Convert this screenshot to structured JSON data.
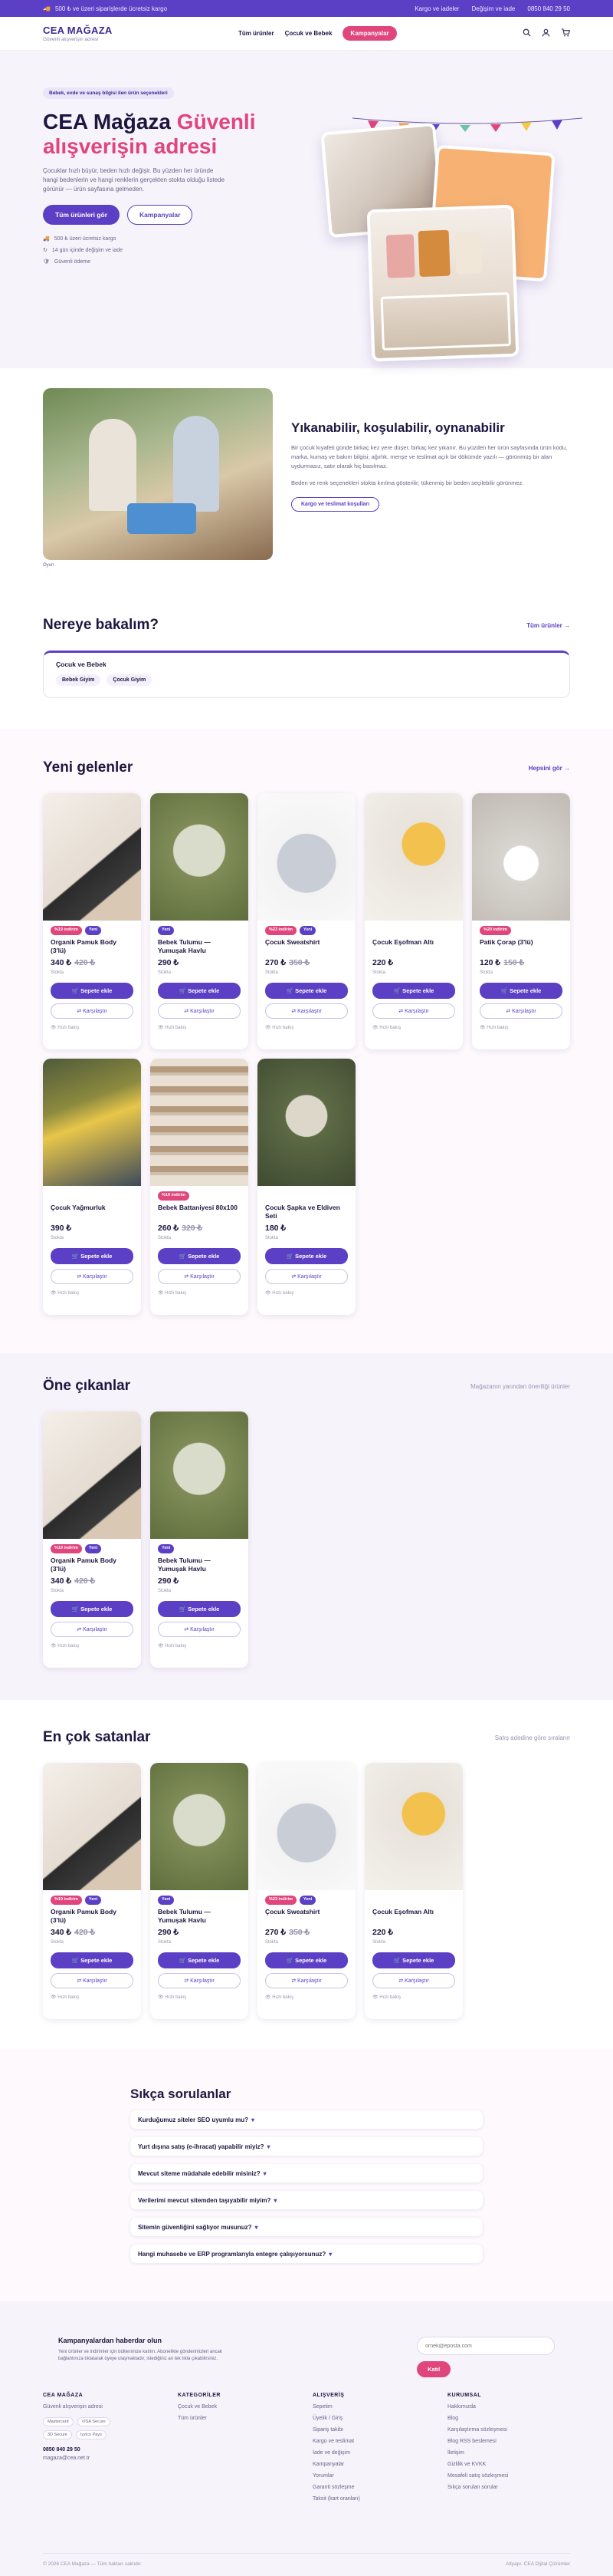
{
  "topbar": {
    "promo": "500 ₺ ve üzeri siparişlerde ücretsiz kargo",
    "links": [
      "Kargo ve iadeler",
      "Değişim ve iade",
      "0850 840 29 50"
    ]
  },
  "header": {
    "brand": "CEA MAĞAZA",
    "tagline": "Güvenli alışverişin adresi",
    "nav": [
      "Tüm ürünler",
      "Çocuk ve Bebek",
      "Kampanyalar"
    ],
    "icons": [
      "search-icon",
      "user-icon",
      "cart-icon"
    ]
  },
  "hero": {
    "badge": "Bebek, evde ve sunaş bilgisi ilen ürün seçenekleri",
    "title_1": "CEA Mağaza",
    "title_accent_1": "Güvenli",
    "title_accent_2": "alışverişin adresi",
    "lead": "Çocuklar hızlı büyür, beden hızlı değişir. Bu yüzden her üründe hangi bedenlerin ve hangi renklerin gerçekten stokta olduğu listede görünür — ürün sayfasına gelmeden.",
    "cta_primary": "Tüm ürünleri gör",
    "cta_secondary": "Kampanyalar",
    "perks": [
      "500 ₺ üzeri ücretsiz kargo",
      "14 gün içinde değişim ve iade",
      "Güvenli ödeme"
    ]
  },
  "wash": {
    "title": "Yıkanabilir, koşulabilir, oynanabilir",
    "p1": "Bir çocuk kıyafeti günde birkaç kez yere düşer, birkaç kez yıkanır. Bu yüzden her ürün sayfasında ürün kodu, marka, kumaş ve bakım bilgisi; ağırlık, menşe ve teslimat açık bir dökümde yazılı — görünmüş bir alan uydurmasız, satır olarak hiç basılmaz.",
    "p2": "Beden ve renk seçenekleri stokta kırılma gösterilir; tükenmiş bir beden seçilebilir görünmez.",
    "button": "Kargo ve teslimat koşulları",
    "caption": "Oyun"
  },
  "categories": {
    "title": "Nereye bakalım?",
    "link": "Tüm ürünler",
    "box_title": "Çocuk ve Bebek",
    "chips": [
      "Bebek Giyim",
      "Çocuk Giyim"
    ]
  },
  "new_arrivals": {
    "title": "Yeni gelenler",
    "link": "Hepsini gör",
    "products": [
      {
        "name": "Organik Pamuk Body (3'lü)",
        "price": "340 ₺",
        "old": "420 ₺",
        "sale": "%19 indirim",
        "new": "Yeni",
        "stock": "Stokta"
      },
      {
        "name": "Bebek Tulumu — Yumuşak Havlu",
        "price": "290 ₺",
        "old": "",
        "sale": "",
        "new": "Yeni",
        "stock": "Stokta"
      },
      {
        "name": "Çocuk Sweatshirt",
        "price": "270 ₺",
        "old": "350 ₺",
        "sale": "%23 indirim",
        "new": "Yeni",
        "stock": "Stokta"
      },
      {
        "name": "Çocuk Eşofman Altı",
        "price": "220 ₺",
        "old": "",
        "sale": "",
        "new": "",
        "stock": "Stokta"
      },
      {
        "name": "Patik Çorap (3'lü)",
        "price": "120 ₺",
        "old": "150 ₺",
        "sale": "%20 indirim",
        "new": "",
        "stock": "Stokta"
      },
      {
        "name": "Çocuk Yağmurluk",
        "price": "390 ₺",
        "old": "",
        "sale": "",
        "new": "",
        "stock": "Stokta"
      },
      {
        "name": "Bebek Battaniyesi 80x100",
        "price": "260 ₺",
        "old": "320 ₺",
        "sale": "%19 indirim",
        "new": "",
        "stock": "Stokta"
      },
      {
        "name": "Çocuk Şapka ve Eldiven Seti",
        "price": "180 ₺",
        "old": "",
        "sale": "",
        "new": "",
        "stock": "Stokta"
      }
    ]
  },
  "featured": {
    "title": "Öne çıkanlar",
    "link": "Mağazanın yarından öneriliği ürünler",
    "products": [
      {
        "name": "Organik Pamuk Body (3'lü)",
        "price": "340 ₺",
        "old": "420 ₺",
        "sale": "%19 indirim",
        "new": "Yeni",
        "stock": "Stokta"
      },
      {
        "name": "Bebek Tulumu — Yumuşak Havlu",
        "price": "290 ₺",
        "old": "",
        "sale": "",
        "new": "Yeni",
        "stock": "Stokta"
      }
    ]
  },
  "bestsellers": {
    "title": "En çok satanlar",
    "link": "Satış adedine göre sıralanır",
    "products": [
      {
        "name": "Organik Pamuk Body (3'lü)",
        "price": "340 ₺",
        "old": "420 ₺",
        "sale": "%19 indirim",
        "new": "Yeni",
        "stock": "Stokta"
      },
      {
        "name": "Bebek Tulumu — Yumuşak Havlu",
        "price": "290 ₺",
        "old": "",
        "sale": "",
        "new": "Yeni",
        "stock": "Stokta"
      },
      {
        "name": "Çocuk Sweatshirt",
        "price": "270 ₺",
        "old": "350 ₺",
        "sale": "%23 indirim",
        "new": "Yeni",
        "stock": "Stokta"
      },
      {
        "name": "Çocuk Eşofman Altı",
        "price": "220 ₺",
        "old": "",
        "sale": "",
        "new": "",
        "stock": "Stokta"
      }
    ]
  },
  "card_labels": {
    "add": "Sepete ekle",
    "compare": "Karşılaştır",
    "fast": "Hızlı bakış"
  },
  "faq": {
    "title": "Sıkça sorulanlar",
    "items": [
      "Kurduğumuz siteler SEO uyumlu mu?",
      "Yurt dışına satış (e-ihracat) yapabilir miyiz?",
      "Mevcut siteme müdahale edebilir misiniz?",
      "Verilerimi mevcut sitemden taşıyabilir miyim?",
      "Sitemin güvenliğini sağlıyor musunuz?",
      "Hangi muhasebe ve ERP programlarıyla entegre çalışıyorsunuz?"
    ]
  },
  "newsletter": {
    "title": "Kampanyalardan haberdar olun",
    "text": "Yeni ürünler ve indirimler için bültenimize katılın. Abonelikte gönderimizleri ancak bağlantınıza tıklatarak üyeye ulaşmaktadır, istediğiniz an tek tıkla çıkabilirsiniz.",
    "placeholder": "ornek@eposta.com",
    "button": "Katıl"
  },
  "footer": {
    "brand": "CEA MAĞAZA",
    "tagline": "Güvenli alışverişin adresi",
    "payments": [
      "Mastercard",
      "VISA Secure",
      "3D Secure",
      "Iyzico Pays"
    ],
    "phone": "0850 840 29 50",
    "email": "magaza@cea.net.tr",
    "cols": [
      {
        "title": "KATEGORİLER",
        "items": [
          "Çocuk ve Bebek",
          "Tüm ürünler"
        ]
      },
      {
        "title": "ALIŞVERİŞ",
        "items": [
          "Sepetim",
          "Üyelik / Giriş",
          "Sipariş takibi",
          "Kargo ve teslimat",
          "İade ve değişim",
          "Kampanyalar",
          "Yorumlar",
          "Garanti sözleşme",
          "Taksit (kart oranları)"
        ]
      },
      {
        "title": "KURUMSAL",
        "items": [
          "Hakkımızda",
          "Blog",
          "Karşılaştırma sözleşmesi",
          "Blog RSS beslemesi",
          "İletişim",
          "Gizlilik ve KVKK",
          "Mesafeli satış sözleşmesi",
          "Sıkça sorulan sorular"
        ]
      }
    ],
    "copyright": "© 2026 CEA Mağaza — Tüm hakları saklıdır.",
    "credit": "Altyapı: CEA Dijital Çözümler"
  },
  "colors": {
    "accent": "#5b3fc4",
    "pink": "#e0457b",
    "hero_bg": "#f7f3fb"
  }
}
